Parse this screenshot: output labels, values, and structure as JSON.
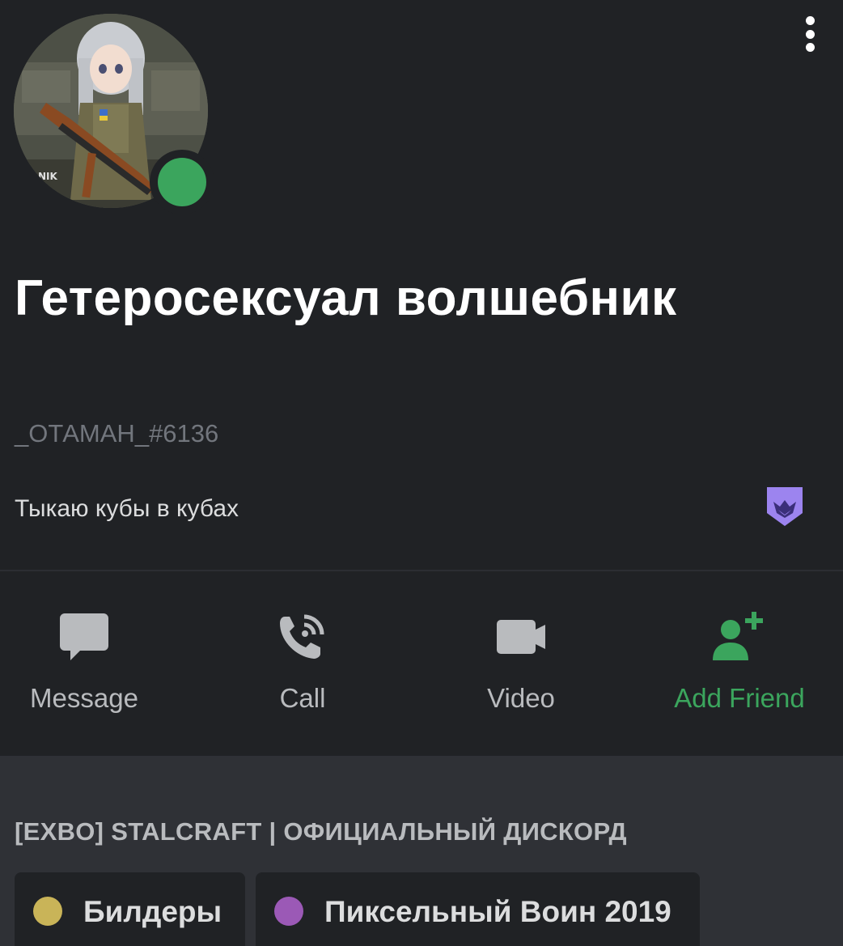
{
  "profile": {
    "display_name": "Гетеросексуал волшебник",
    "tag": "_ОТАМАН_#6136",
    "about": "Тыкаю кубы в кубах",
    "status": "online",
    "status_color": "#3ba55d",
    "badge_icon": "hypesquad-badge-icon",
    "badge_color": "#9c84ef"
  },
  "menu": {
    "icon": "more-vertical-icon"
  },
  "actions": [
    {
      "label": "Message",
      "icon": "message-icon"
    },
    {
      "label": "Call",
      "icon": "call-icon"
    },
    {
      "label": "Video",
      "icon": "video-icon"
    },
    {
      "label": "Add Friend",
      "icon": "add-friend-icon",
      "color": "#3ba55d"
    }
  ],
  "server": {
    "name": "[EXBO] STALCRAFT | ОФИЦИАЛЬНЫЙ ДИСКОРД",
    "roles": [
      {
        "name": "Билдеры",
        "color": "#c9b458"
      },
      {
        "name": "Пиксельный Воин 2019",
        "color": "#9b59b6"
      }
    ]
  }
}
